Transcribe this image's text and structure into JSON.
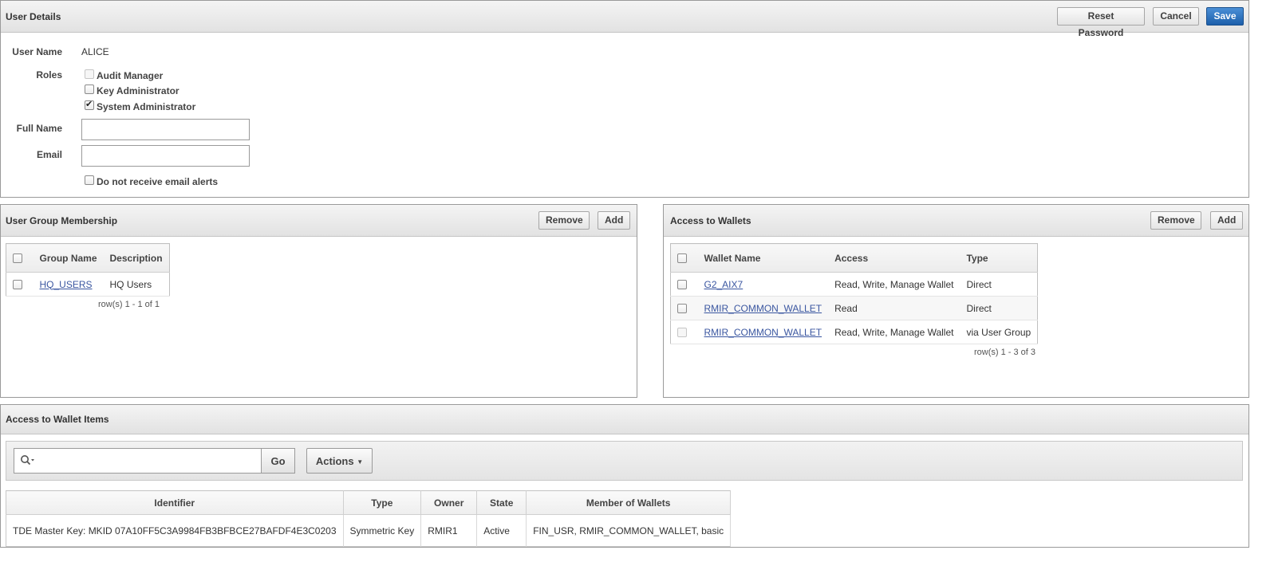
{
  "user_details": {
    "title": "User Details",
    "buttons": {
      "reset_password": "Reset Password",
      "cancel": "Cancel",
      "save": "Save"
    },
    "user_name_label": "User Name",
    "user_name_value": "ALICE",
    "roles_label": "Roles",
    "roles": [
      {
        "label": "Audit Manager",
        "checked": false,
        "disabled": true
      },
      {
        "label": "Key Administrator",
        "checked": false,
        "disabled": false
      },
      {
        "label": "System Administrator",
        "checked": true,
        "disabled": false
      }
    ],
    "full_name_label": "Full Name",
    "full_name_value": "",
    "email_label": "Email",
    "email_value": "",
    "email_alerts_label": "Do not receive email alerts"
  },
  "group_membership": {
    "title": "User Group Membership",
    "buttons": {
      "remove": "Remove",
      "add": "Add"
    },
    "columns": [
      "Group Name",
      "Description"
    ],
    "rows": [
      {
        "group_name": "HQ_USERS",
        "description": "HQ Users"
      }
    ],
    "pagination": "row(s) 1 - 1 of 1"
  },
  "wallet_access": {
    "title": "Access to Wallets",
    "buttons": {
      "remove": "Remove",
      "add": "Add"
    },
    "columns": [
      "Wallet Name",
      "Access",
      "Type"
    ],
    "rows": [
      {
        "wallet_name": "G2_AIX7",
        "access": "Read, Write, Manage Wallet",
        "type": "Direct"
      },
      {
        "wallet_name": "RMIR_COMMON_WALLET",
        "access": "Read",
        "type": "Direct"
      },
      {
        "wallet_name": "RMIR_COMMON_WALLET",
        "access": "Read, Write, Manage Wallet",
        "type": "via User Group"
      }
    ],
    "pagination": "row(s) 1 - 3 of 3"
  },
  "wallet_items": {
    "title": "Access to Wallet Items",
    "search_placeholder": "",
    "go_label": "Go",
    "actions_label": "Actions",
    "columns": [
      "Identifier",
      "Type",
      "Owner",
      "State",
      "Member of Wallets"
    ],
    "rows": [
      {
        "identifier": "TDE Master Key: MKID 07A10FF5C3A9984FB3BFBCE27BAFDF4E3C0203",
        "type": "Symmetric Key",
        "owner": "RMIR1",
        "state": "Active",
        "member_of_wallets": "FIN_USR, RMIR_COMMON_WALLET, basic"
      }
    ]
  },
  "icons": {
    "search": "search-icon",
    "dropdown": "caret-down-icon",
    "checkmark": "check-icon"
  },
  "colors": {
    "primary_button": "#1c5fab",
    "link": "#3a56a0",
    "header_bg": "#e2e2e2"
  }
}
